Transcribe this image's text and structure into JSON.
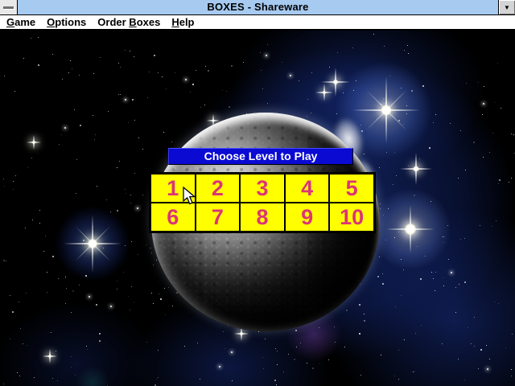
{
  "window": {
    "title": "BOXES - Shareware",
    "controls": {
      "minimize_glyph": "▼"
    }
  },
  "menubar": {
    "items": [
      {
        "pre": "",
        "accel": "G",
        "post": "ame"
      },
      {
        "pre": "",
        "accel": "O",
        "post": "ptions"
      },
      {
        "pre": "Order ",
        "accel": "B",
        "post": "oxes"
      },
      {
        "pre": "",
        "accel": "H",
        "post": "elp"
      }
    ]
  },
  "level_dialog": {
    "title": "Choose Level to Play",
    "levels": [
      "1",
      "2",
      "3",
      "4",
      "5",
      "6",
      "7",
      "8",
      "9",
      "10"
    ]
  },
  "colors": {
    "titlebar_bg": "#A6CAF0",
    "menubar_bg": "#FFFFFF",
    "dialog_header_bg": "#0A0AD2",
    "dialog_header_text": "#FFFFFF",
    "level_grid_bg": "#FFFF00",
    "level_number": "#DB3576",
    "space_bg": "#000000",
    "nebula_blue": "#1E3C96"
  }
}
